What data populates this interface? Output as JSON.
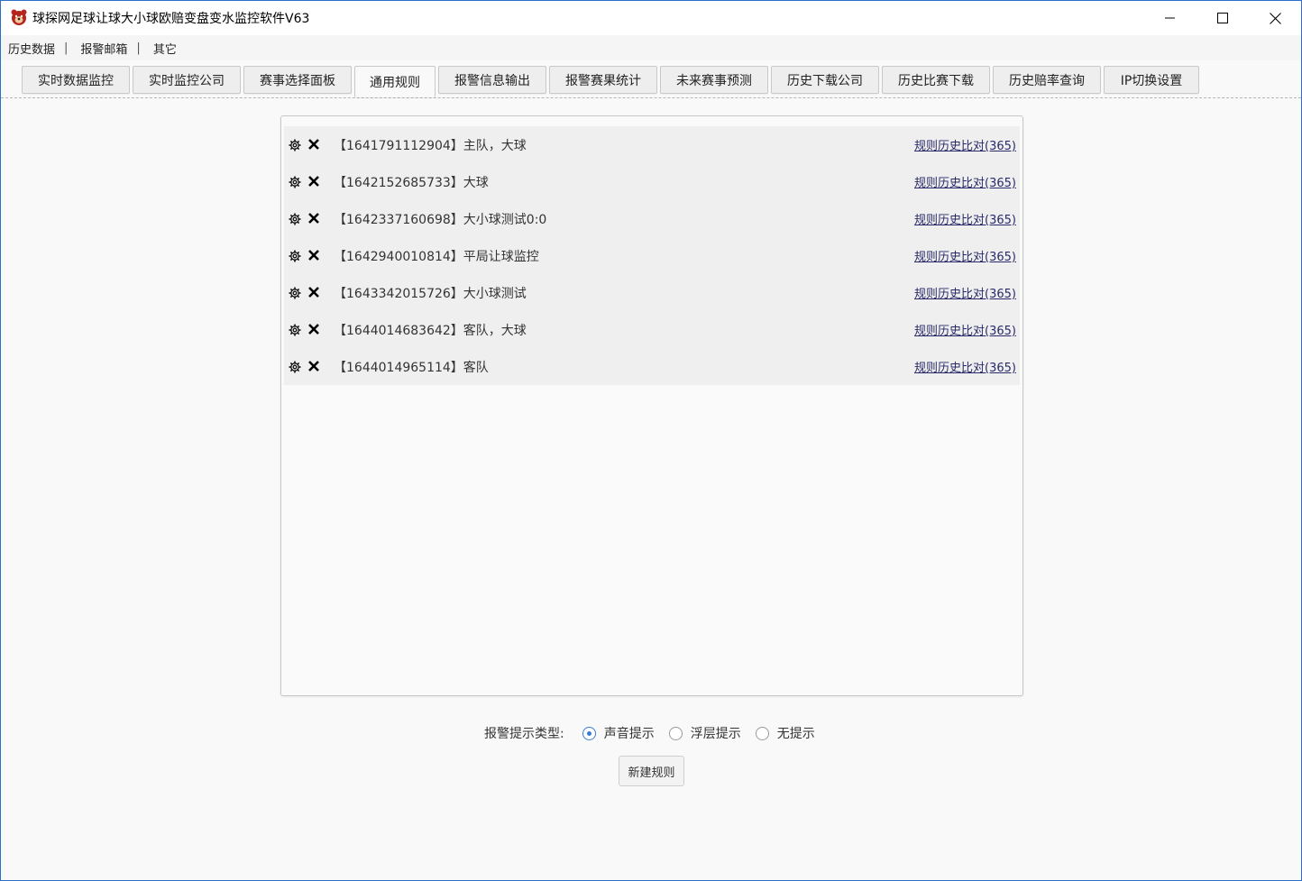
{
  "window": {
    "title": "球探网足球让球大小球欧赔变盘变水监控软件V63",
    "icon": "bear-logo-icon"
  },
  "menu": {
    "items": [
      "历史数据",
      "报警邮箱",
      "其它"
    ],
    "separator": "|"
  },
  "tabs": [
    {
      "label": "实时数据监控",
      "active": false
    },
    {
      "label": "实时监控公司",
      "active": false
    },
    {
      "label": "赛事选择面板",
      "active": false
    },
    {
      "label": "通用规则",
      "active": true
    },
    {
      "label": "报警信息输出",
      "active": false
    },
    {
      "label": "报警赛果统计",
      "active": false
    },
    {
      "label": "未来赛事预测",
      "active": false
    },
    {
      "label": "历史下载公司",
      "active": false
    },
    {
      "label": "历史比赛下载",
      "active": false
    },
    {
      "label": "历史赔率查询",
      "active": false
    },
    {
      "label": "IP切换设置",
      "active": false
    }
  ],
  "rules": [
    {
      "text": "【1641791112904】主队，大球",
      "link": "规则历史比对(365)"
    },
    {
      "text": "【1642152685733】大球",
      "link": "规则历史比对(365)"
    },
    {
      "text": "【1642337160698】大小球测试0:0",
      "link": "规则历史比对(365)"
    },
    {
      "text": "【1642940010814】平局让球监控",
      "link": "规则历史比对(365)"
    },
    {
      "text": "【1643342015726】大小球测试",
      "link": "规则历史比对(365)"
    },
    {
      "text": "【1644014683642】客队，大球",
      "link": "规则历史比对(365)"
    },
    {
      "text": "【1644014965114】客队",
      "link": "规则历史比对(365)"
    }
  ],
  "alert": {
    "label": "报警提示类型:",
    "options": [
      {
        "label": "声音提示",
        "checked": true
      },
      {
        "label": "浮层提示",
        "checked": false
      },
      {
        "label": "无提示",
        "checked": false
      }
    ]
  },
  "new_rule_button": "新建规则",
  "colors": {
    "accent": "#3b7bd6",
    "link": "#2a2a6a",
    "window_border": "#2b6fc7"
  }
}
